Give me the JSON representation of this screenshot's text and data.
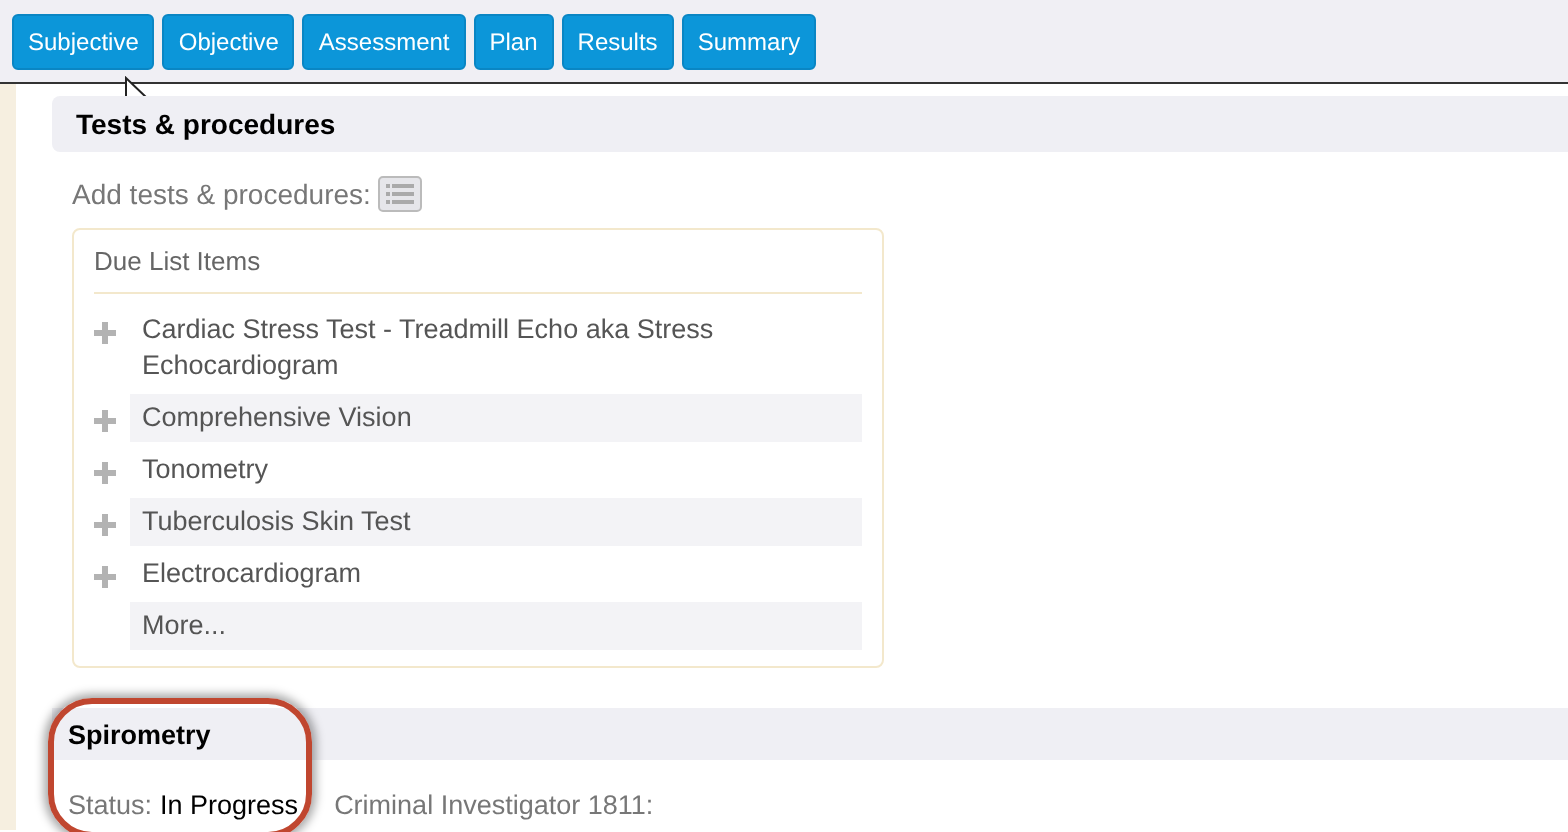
{
  "tabs": [
    {
      "label": "Subjective"
    },
    {
      "label": "Objective"
    },
    {
      "label": "Assessment"
    },
    {
      "label": "Plan"
    },
    {
      "label": "Results"
    },
    {
      "label": "Summary"
    }
  ],
  "tests_section": {
    "title": "Tests & procedures",
    "add_label": "Add tests & procedures:",
    "due_list": {
      "title": "Due List Items",
      "items": [
        {
          "label": "Cardiac Stress Test - Treadmill Echo aka Stress Echocardiogram",
          "kind": "item"
        },
        {
          "label": "Comprehensive Vision",
          "kind": "item"
        },
        {
          "label": "Tonometry",
          "kind": "item"
        },
        {
          "label": "Tuberculosis Skin Test",
          "kind": "item"
        },
        {
          "label": "Electrocardiogram",
          "kind": "item"
        },
        {
          "label": "More...",
          "kind": "more"
        }
      ]
    }
  },
  "spirometry_section": {
    "title": "Spirometry",
    "status_label": "Status:",
    "status_value": "In Progress",
    "performer": "Criminal Investigator 1811:"
  }
}
